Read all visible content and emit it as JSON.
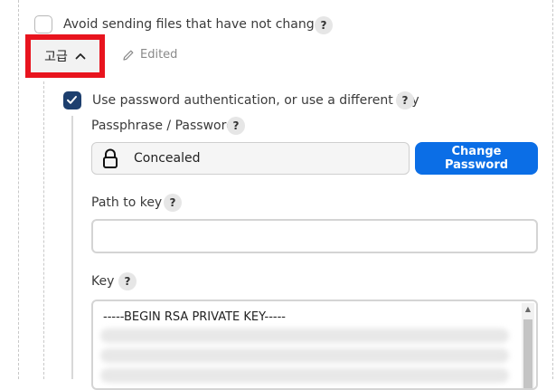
{
  "avoid_sending": {
    "label": "Avoid sending files that have not changed",
    "checked": false,
    "help": "?"
  },
  "advanced": {
    "label": "고급",
    "edited_label": "Edited"
  },
  "use_password_auth": {
    "label": "Use password authentication, or use a different key",
    "checked": true,
    "help": "?"
  },
  "passphrase": {
    "label": "Passphrase / Password",
    "help": "?",
    "value": "Concealed",
    "change_button": "Change Password"
  },
  "path_to_key": {
    "label": "Path to key",
    "help": "?",
    "value": ""
  },
  "key": {
    "label": "Key",
    "help": "?",
    "first_line": "-----BEGIN RSA PRIVATE KEY-----"
  },
  "colors": {
    "accent": "#0b6ee6",
    "checkbox_checked": "#1d3f6e",
    "highlight_border": "#e8141e"
  }
}
